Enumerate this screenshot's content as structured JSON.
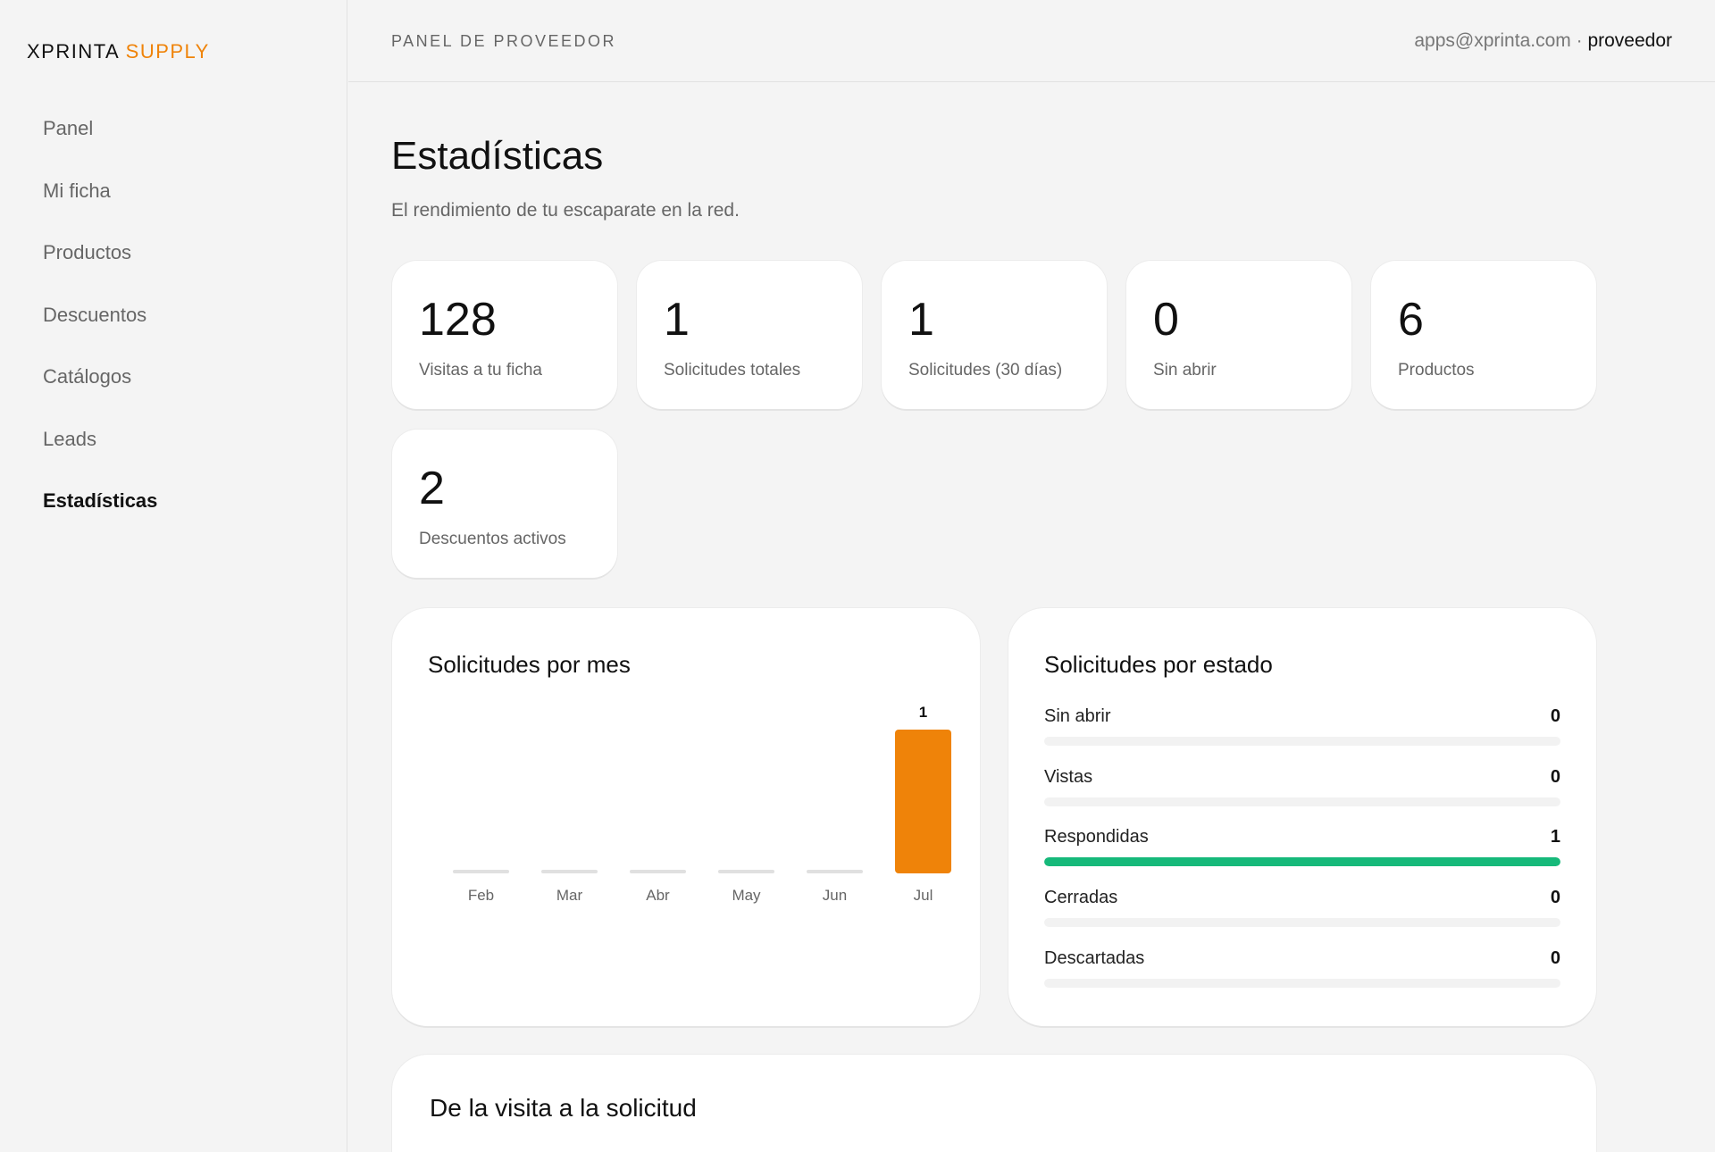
{
  "brand": {
    "name": "XPRINTA",
    "accent": "SUPPLY",
    "accent_color": "#ef8309"
  },
  "sidebar": {
    "items": [
      {
        "label": "Panel",
        "active": false
      },
      {
        "label": "Mi ficha",
        "active": false
      },
      {
        "label": "Productos",
        "active": false
      },
      {
        "label": "Descuentos",
        "active": false
      },
      {
        "label": "Catálogos",
        "active": false
      },
      {
        "label": "Leads",
        "active": false
      },
      {
        "label": "Estadísticas",
        "active": true
      }
    ]
  },
  "header": {
    "section": "PANEL DE PROVEEDOR",
    "email": "apps@xprinta.com",
    "separator": " · ",
    "role": "proveedor"
  },
  "page": {
    "title": "Estadísticas",
    "subtitle": "El rendimiento de tu escaparate en la red."
  },
  "stats": [
    {
      "value": "128",
      "label": "Visitas a tu ficha"
    },
    {
      "value": "1",
      "label": "Solicitudes totales"
    },
    {
      "value": "1",
      "label": "Solicitudes (30 días)"
    },
    {
      "value": "0",
      "label": "Sin abrir"
    },
    {
      "value": "6",
      "label": "Productos"
    },
    {
      "value": "2",
      "label": "Descuentos activos"
    }
  ],
  "monthly_panel": {
    "title": "Solicitudes por mes"
  },
  "status_panel": {
    "title": "Solicitudes por estado",
    "rows": [
      {
        "label": "Sin abrir",
        "count": "0",
        "fraction": 0
      },
      {
        "label": "Vistas",
        "count": "0",
        "fraction": 0
      },
      {
        "label": "Respondidas",
        "count": "1",
        "fraction": 1
      },
      {
        "label": "Cerradas",
        "count": "0",
        "fraction": 0
      },
      {
        "label": "Descartadas",
        "count": "0",
        "fraction": 0
      }
    ],
    "fill_color": "#16b97a"
  },
  "funnel_panel": {
    "title": "De la visita a la solicitud"
  },
  "chart_data": {
    "type": "bar",
    "title": "Solicitudes por mes",
    "categories": [
      "Feb",
      "Mar",
      "Abr",
      "May",
      "Jun",
      "Jul"
    ],
    "values": [
      0,
      0,
      0,
      0,
      0,
      1
    ],
    "data_labels": [
      "",
      "",
      "",
      "",
      "",
      "1"
    ],
    "ylim": [
      0,
      1
    ],
    "grid": false,
    "bar_color": "#ef8309",
    "empty_bar_color": "#e0e0e0"
  }
}
